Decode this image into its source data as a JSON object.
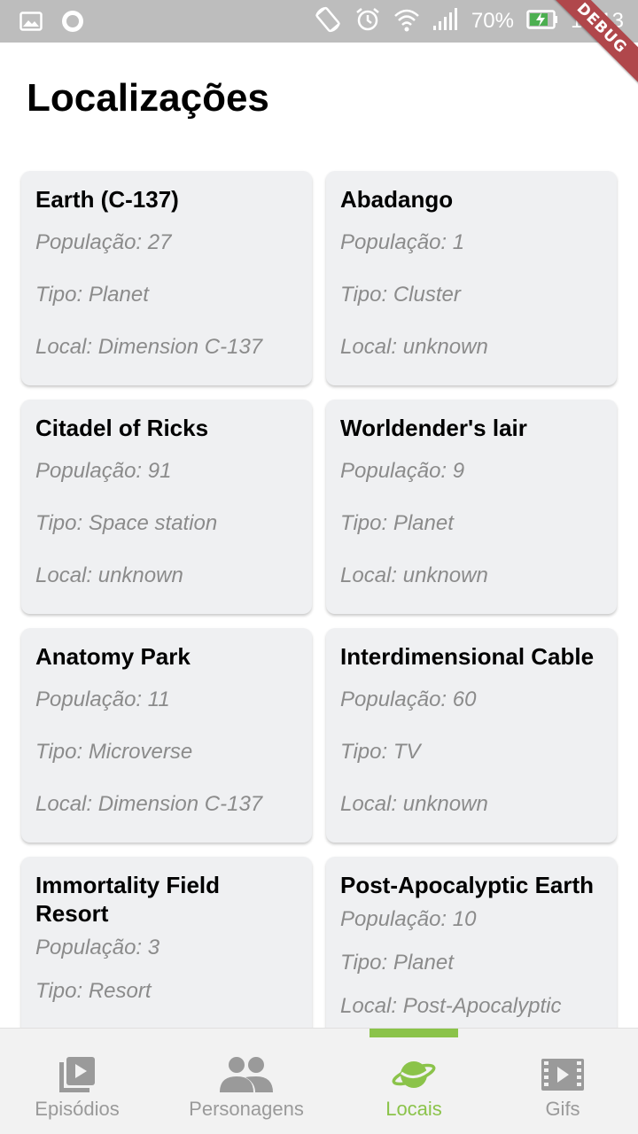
{
  "status_bar": {
    "battery_percent": "70%",
    "time": "14:13",
    "debug_label": "DEBUG"
  },
  "page": {
    "title": "Localizações"
  },
  "labels": {
    "population": "População: ",
    "type": "Tipo: ",
    "dimension": "Local: "
  },
  "locations": [
    {
      "name": "Earth (C-137)",
      "population": "27",
      "type": "Planet",
      "dimension": "Dimension C-137"
    },
    {
      "name": "Abadango",
      "population": "1",
      "type": "Cluster",
      "dimension": "unknown"
    },
    {
      "name": "Citadel of Ricks",
      "population": "91",
      "type": "Space station",
      "dimension": "unknown"
    },
    {
      "name": "Worldender's lair",
      "population": "9",
      "type": "Planet",
      "dimension": "unknown"
    },
    {
      "name": "Anatomy Park",
      "population": "11",
      "type": "Microverse",
      "dimension": "Dimension C-137"
    },
    {
      "name": "Interdimensional Cable",
      "population": "60",
      "type": "TV",
      "dimension": "unknown"
    },
    {
      "name": "Immortality Field Resort",
      "population": "3",
      "type": "Resort",
      "dimension": ""
    },
    {
      "name": "Post-Apocalyptic Earth",
      "population": "10",
      "type": "Planet",
      "dimension": "Post-Apocalyptic"
    }
  ],
  "bottom_nav": {
    "items": [
      {
        "label": "Episódios",
        "icon": "video-library-icon",
        "active": false
      },
      {
        "label": "Personagens",
        "icon": "people-icon",
        "active": false
      },
      {
        "label": "Locais",
        "icon": "planet-icon",
        "active": true
      },
      {
        "label": "Gifs",
        "icon": "film-icon",
        "active": false
      }
    ]
  },
  "colors": {
    "accent": "#8bc34a",
    "card_bg": "#eff0f2",
    "muted_text": "#8b8b8b",
    "status_bar": "#bdbdbd",
    "debug_banner": "#b0474b"
  }
}
